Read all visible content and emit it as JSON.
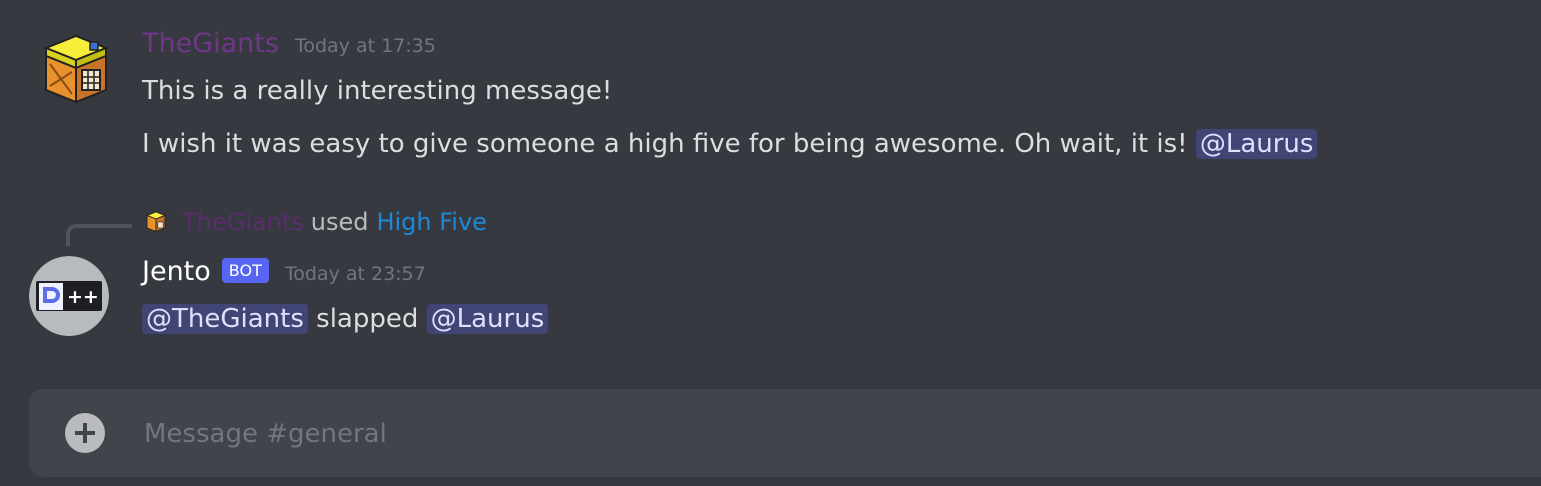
{
  "colors": {
    "background": "#36393f",
    "thegiants_name": "#71368a",
    "jento_name": "#ffffff",
    "command_link": "#1e88d6",
    "mention_bg": "#414675",
    "bot_tag": "#5865f2",
    "composer_bg": "#40444b"
  },
  "messages": [
    {
      "author": "TheGiants",
      "timestamp": "Today at 17:35",
      "avatar_icon": "box-avatar-icon",
      "lines": [
        {
          "text": "This is a really interesting message!"
        },
        {
          "text": "I wish it was easy to give someone a high five for being awesome. Oh wait, it is!",
          "mention": "@Laurus"
        }
      ]
    },
    {
      "author": "Jento",
      "bot_tag": "BOT",
      "timestamp": "Today at 23:57",
      "avatar_icon": "dpp-bot-avatar-icon",
      "reply": {
        "user": "TheGiants",
        "used_text": "used",
        "command": "High Five"
      },
      "content": {
        "mention_1": "@TheGiants",
        "verb": "slapped",
        "mention_2": "@Laurus"
      }
    }
  ],
  "composer": {
    "placeholder": "Message #general",
    "plus_icon": "plus-circle-icon"
  }
}
